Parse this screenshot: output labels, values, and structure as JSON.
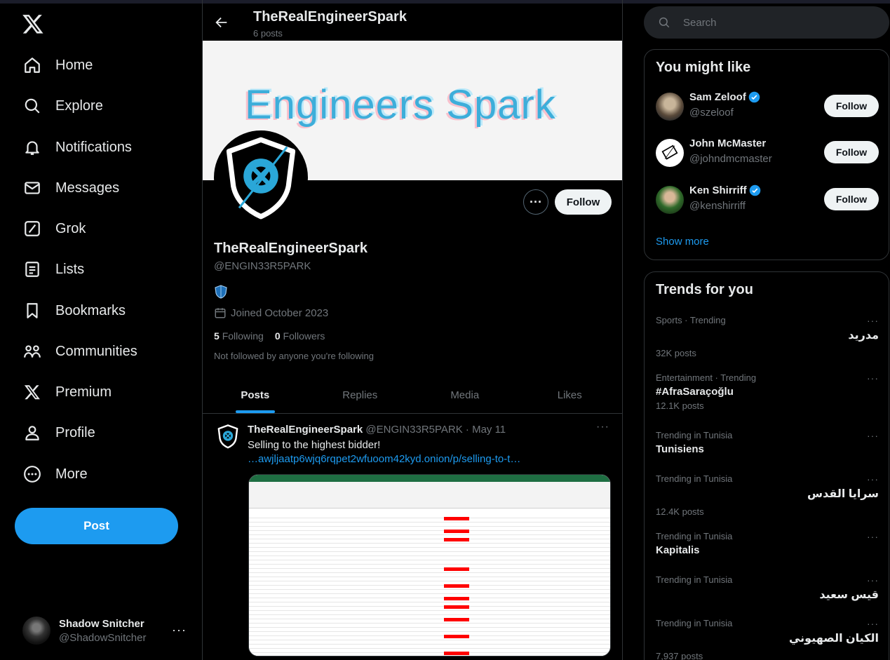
{
  "nav": {
    "items": [
      {
        "label": "Home",
        "icon": "home-icon"
      },
      {
        "label": "Explore",
        "icon": "search-icon"
      },
      {
        "label": "Notifications",
        "icon": "bell-icon"
      },
      {
        "label": "Messages",
        "icon": "envelope-icon"
      },
      {
        "label": "Grok",
        "icon": "grok-icon"
      },
      {
        "label": "Lists",
        "icon": "list-icon"
      },
      {
        "label": "Bookmarks",
        "icon": "bookmark-icon"
      },
      {
        "label": "Communities",
        "icon": "communities-icon"
      },
      {
        "label": "Premium",
        "icon": "x-icon"
      },
      {
        "label": "Profile",
        "icon": "person-icon"
      },
      {
        "label": "More",
        "icon": "more-circle-icon"
      }
    ],
    "post_label": "Post"
  },
  "account": {
    "name": "Shadow Snitcher",
    "handle": "@ShadowSnitcher"
  },
  "header": {
    "title": "TheRealEngineerSpark",
    "subtitle": "6 posts"
  },
  "banner": {
    "text": "Engineers Spark"
  },
  "profile": {
    "follow_label": "Follow",
    "more_label": "···",
    "name": "TheRealEngineerSpark",
    "handle": "@ENGIN33R5PARK",
    "joined": "Joined October 2023",
    "following_count": "5",
    "following_label": "Following",
    "followers_count": "0",
    "followers_label": "Followers",
    "not_followed": "Not followed by anyone you're following"
  },
  "tabs": [
    "Posts",
    "Replies",
    "Media",
    "Likes"
  ],
  "tweet": {
    "name": "TheRealEngineerSpark",
    "handle": "@ENGIN33R5PARK",
    "date": "May 11",
    "text": "Selling to the highest bidder!",
    "link": "…awjljaatp6wjq6rqpet2wfuoom42kyd.onion/p/selling-to-t…"
  },
  "search": {
    "placeholder": "Search"
  },
  "you_might_like": {
    "title": "You might like",
    "users": [
      {
        "name": "Sam Zeloof",
        "handle": "@szeloof",
        "verified": true,
        "follow": "Follow"
      },
      {
        "name": "John McMaster",
        "handle": "@johndmcmaster",
        "verified": false,
        "follow": "Follow"
      },
      {
        "name": "Ken Shirriff",
        "handle": "@kenshirriff",
        "verified": true,
        "follow": "Follow"
      }
    ],
    "show_more": "Show more"
  },
  "trends": {
    "title": "Trends for you",
    "items": [
      {
        "meta": "Sports · Trending",
        "name": "مدريد",
        "count": "32K posts",
        "rtl": true
      },
      {
        "meta": "Entertainment · Trending",
        "name": "#AfraSaraçoğlu",
        "count": "12.1K posts",
        "rtl": false
      },
      {
        "meta": "Trending in Tunisia",
        "name": "Tunisiens",
        "count": "",
        "rtl": false
      },
      {
        "meta": "Trending in Tunisia",
        "name": "سرايا القدس",
        "count": "12.4K posts",
        "rtl": true
      },
      {
        "meta": "Trending in Tunisia",
        "name": "Kapitalis",
        "count": "",
        "rtl": false
      },
      {
        "meta": "Trending in Tunisia",
        "name": "قيس سعيد",
        "count": "",
        "rtl": true
      },
      {
        "meta": "Trending in Tunisia",
        "name": "الكيان الصهيوني",
        "count": "7,937 posts",
        "rtl": true
      }
    ]
  },
  "colors": {
    "accent": "#1d9bf0",
    "background": "#000000",
    "muted": "#71767b",
    "text": "#e7e9ea"
  }
}
